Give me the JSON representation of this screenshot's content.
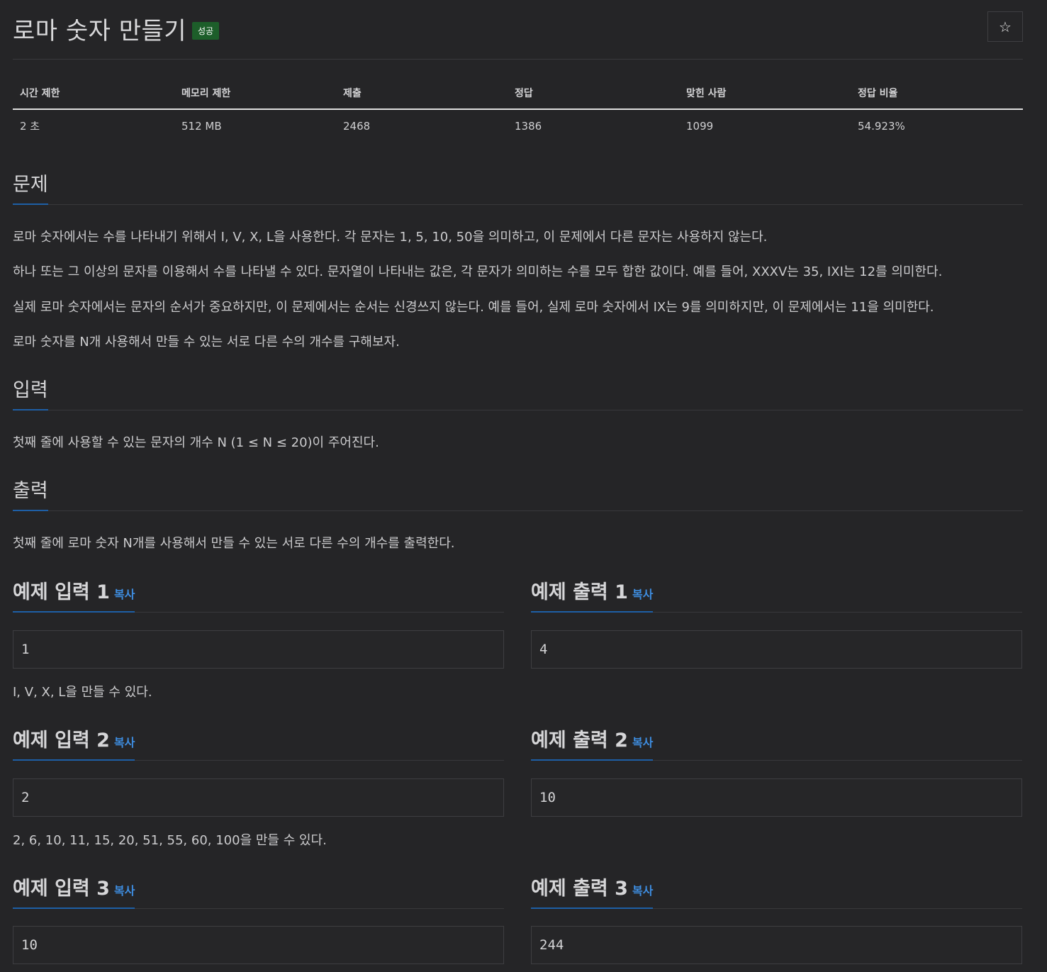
{
  "problem": {
    "title": "로마 숫자 만들기",
    "status_badge": "성공"
  },
  "actions": {
    "star": "☆"
  },
  "info_table": {
    "headers": [
      "시간 제한",
      "메모리 제한",
      "제출",
      "정답",
      "맞힌 사람",
      "정답 비율"
    ],
    "values": [
      "2 초",
      "512 MB",
      "2468",
      "1386",
      "1099",
      "54.923%"
    ]
  },
  "sections": {
    "description": {
      "title": "문제",
      "paragraphs": [
        "로마 숫자에서는 수를 나타내기 위해서 I, V, X, L을 사용한다. 각 문자는 1, 5, 10, 50을 의미하고, 이 문제에서 다른 문자는 사용하지 않는다.",
        "하나 또는 그 이상의 문자를 이용해서 수를 나타낼 수 있다. 문자열이 나타내는 값은, 각 문자가 의미하는 수를 모두 합한 값이다. 예를 들어, XXXV는 35, IXI는 12를 의미한다.",
        "실제 로마 숫자에서는 문자의 순서가 중요하지만, 이 문제에서는 순서는 신경쓰지 않는다. 예를 들어, 실제 로마 숫자에서 IX는 9를 의미하지만, 이 문제에서는 11을 의미한다.",
        "로마 숫자를 N개 사용해서 만들 수 있는 서로 다른 수의 개수를 구해보자."
      ]
    },
    "input": {
      "title": "입력",
      "text": "첫째 줄에 사용할 수 있는 문자의 개수 N (1 ≤ N ≤ 20)이 주어진다."
    },
    "output": {
      "title": "출력",
      "text": "첫째 줄에 로마 숫자 N개를 사용해서 만들 수 있는 서로 다른 수의 개수를 출력한다."
    }
  },
  "copy_label": "복사",
  "examples": [
    {
      "input_title": "예제 입력 1",
      "output_title": "예제 출력 1",
      "input": "1",
      "output": "4",
      "note": "I, V, X, L을 만들 수 있다."
    },
    {
      "input_title": "예제 입력 2",
      "output_title": "예제 출력 2",
      "input": "2",
      "output": "10",
      "note": "2, 6, 10, 11, 15, 20, 51, 55, 60, 100을 만들 수 있다."
    },
    {
      "input_title": "예제 입력 3",
      "output_title": "예제 출력 3",
      "input": "10",
      "output": "244"
    }
  ]
}
